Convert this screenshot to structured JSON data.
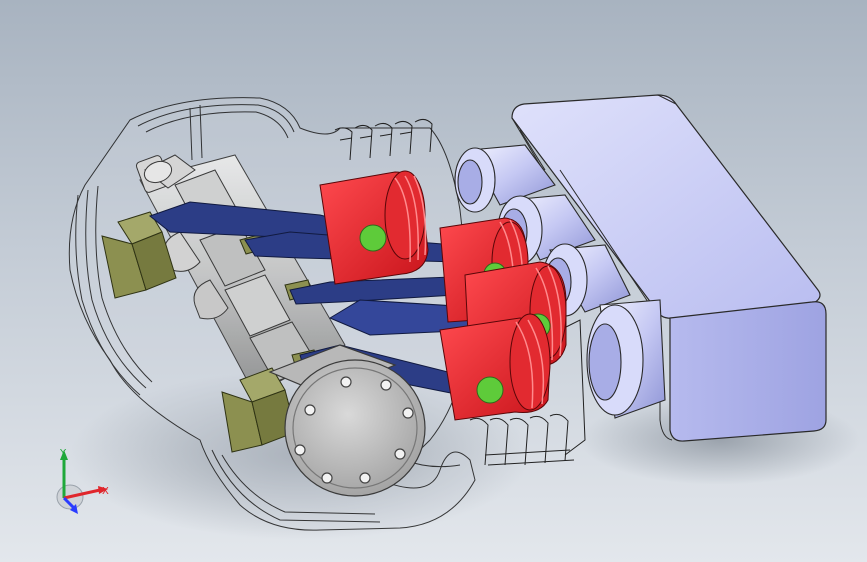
{
  "viewport": {
    "background_top": "#a8b3c0",
    "background_bottom": "#e3e7ec"
  },
  "colors": {
    "piston": "#e8202a",
    "pin": "#5ecb3a",
    "rod": "#2c3d86",
    "bearing": "#8c9050",
    "block_edge": "#1a1a1a",
    "intake": "#c6c9f2",
    "flange": "#b5b5b5"
  },
  "triad": {
    "x_label": "X",
    "y_label": "Y",
    "x_color": "#e0262c",
    "y_color": "#1fa83a",
    "z_color": "#2a3cff"
  }
}
